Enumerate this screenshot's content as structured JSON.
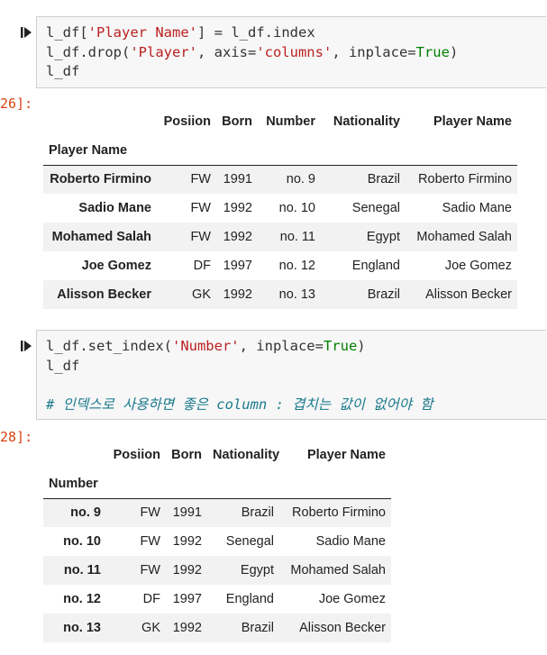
{
  "cell1": {
    "prompt": "26]:",
    "code_lines": [
      [
        {
          "t": "l_df["
        },
        {
          "t": "'Player Name'",
          "c": "str"
        },
        {
          "t": "] = l_df.index"
        }
      ],
      [
        {
          "t": "l_df.drop("
        },
        {
          "t": "'Player'",
          "c": "str"
        },
        {
          "t": ", axis="
        },
        {
          "t": "'columns'",
          "c": "str"
        },
        {
          "t": ", inplace="
        },
        {
          "t": "True",
          "c": "kw"
        },
        {
          "t": ")"
        }
      ],
      [
        {
          "t": "l_df"
        }
      ]
    ],
    "table": {
      "columns": [
        "Posiion",
        "Born",
        "Number",
        "Nationality",
        "Player Name"
      ],
      "index_name": "Player Name",
      "rows": [
        {
          "index": "Roberto Firmino",
          "cells": [
            "FW",
            "1991",
            "no. 9",
            "Brazil",
            "Roberto Firmino"
          ]
        },
        {
          "index": "Sadio Mane",
          "cells": [
            "FW",
            "1992",
            "no. 10",
            "Senegal",
            "Sadio Mane"
          ]
        },
        {
          "index": "Mohamed Salah",
          "cells": [
            "FW",
            "1992",
            "no. 11",
            "Egypt",
            "Mohamed Salah"
          ]
        },
        {
          "index": "Joe Gomez",
          "cells": [
            "DF",
            "1997",
            "no. 12",
            "England",
            "Joe Gomez"
          ]
        },
        {
          "index": "Alisson Becker",
          "cells": [
            "GK",
            "1992",
            "no. 13",
            "Brazil",
            "Alisson Becker"
          ]
        }
      ]
    }
  },
  "cell2": {
    "prompt": "28]:",
    "code_lines": [
      [
        {
          "t": "l_df.set_index("
        },
        {
          "t": "'Number'",
          "c": "str"
        },
        {
          "t": ", inplace="
        },
        {
          "t": "True",
          "c": "kw"
        },
        {
          "t": ")"
        }
      ],
      [
        {
          "t": "l_df"
        }
      ],
      [
        {
          "t": ""
        }
      ],
      [
        {
          "t": "# 인덱스로 사용하면 좋은 column : 겹치는 값이 없어야 함",
          "c": "comment"
        }
      ]
    ],
    "table": {
      "columns": [
        "Posiion",
        "Born",
        "Nationality",
        "Player Name"
      ],
      "index_name": "Number",
      "rows": [
        {
          "index": "no. 9",
          "cells": [
            "FW",
            "1991",
            "Brazil",
            "Roberto Firmino"
          ]
        },
        {
          "index": "no. 10",
          "cells": [
            "FW",
            "1992",
            "Senegal",
            "Sadio Mane"
          ]
        },
        {
          "index": "no. 11",
          "cells": [
            "FW",
            "1992",
            "Egypt",
            "Mohamed Salah"
          ]
        },
        {
          "index": "no. 12",
          "cells": [
            "DF",
            "1997",
            "England",
            "Joe Gomez"
          ]
        },
        {
          "index": "no. 13",
          "cells": [
            "GK",
            "1992",
            "Brazil",
            "Alisson Becker"
          ]
        }
      ]
    }
  }
}
